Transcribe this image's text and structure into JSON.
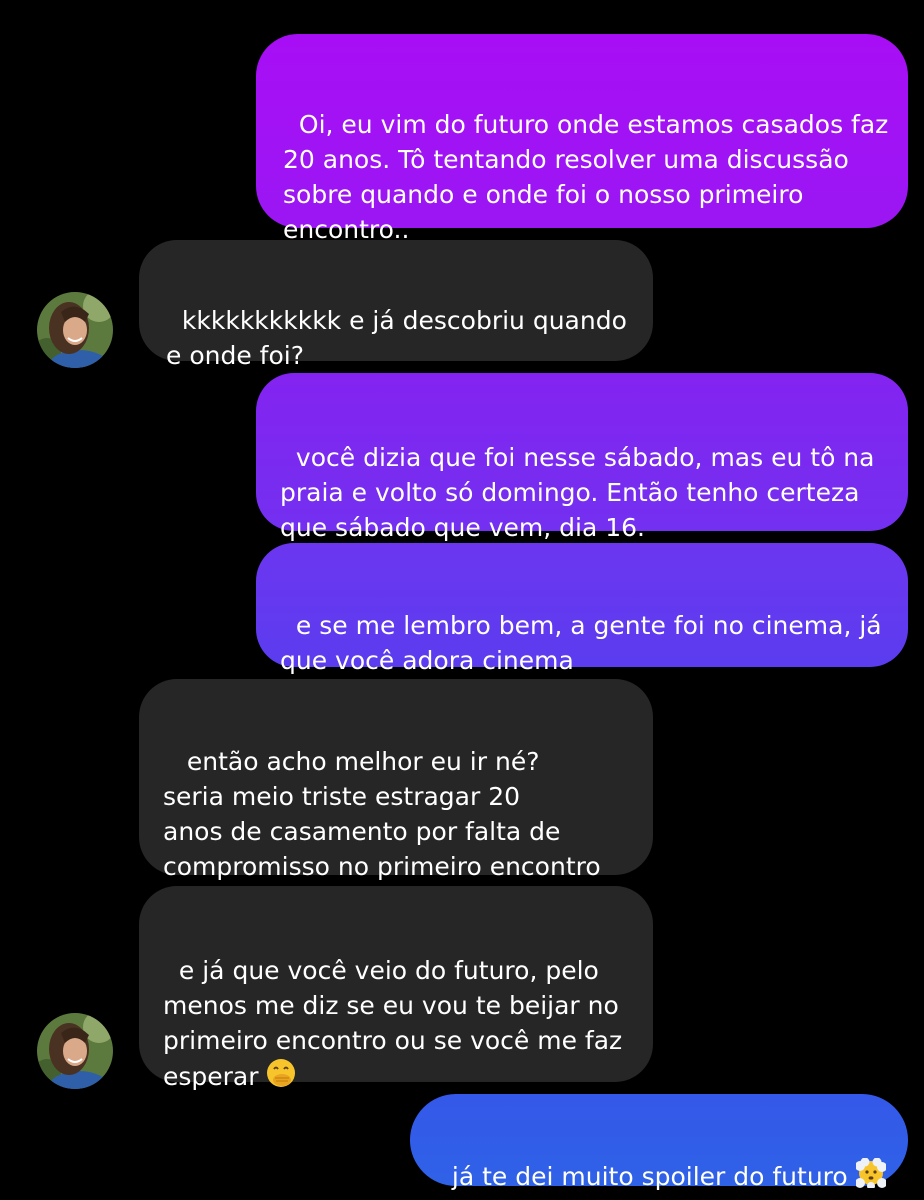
{
  "colors": {
    "background": "#000000",
    "received_bubble": "#262626",
    "gradient_top": "#a80ef5",
    "gradient_bottom": "#2f62e7",
    "text": "#ffffff"
  },
  "messages": [
    {
      "direction": "sent",
      "text": "Oi, eu vim do futuro onde estamos casados faz\n20 anos. Tô tentando resolver uma discussão\nsobre quando e onde foi o nosso primeiro\nencontro.."
    },
    {
      "direction": "received",
      "text": "kkkkkkkkkkk e já descobriu quando\ne onde foi?"
    },
    {
      "direction": "sent",
      "text": "você dizia que foi nesse sábado, mas eu tô na\npraia e volto só domingo. Então tenho certeza\nque sábado que vem, dia 16."
    },
    {
      "direction": "sent",
      "text": "e se me lembro bem, a gente foi no cinema, já\nque você adora cinema"
    },
    {
      "direction": "received",
      "text": " então acho melhor eu ir né?\nseria meio triste estragar 20\nanos de casamento por falta de\ncompromisso no primeiro encontro"
    },
    {
      "direction": "received",
      "text": "e já que você veio do futuro, pelo\nmenos me diz se eu vou te beijar no\nprimeiro encontro ou se você me faz\nesperar ",
      "emoji": "face-with-hand-over-mouth-emoji"
    },
    {
      "direction": "sent",
      "text": "já te dei muito spoiler do futuro ",
      "emoji": "face-in-clouds-emoji"
    }
  ],
  "avatars": [
    {
      "icon": "contact-avatar"
    },
    {
      "icon": "contact-avatar"
    }
  ]
}
